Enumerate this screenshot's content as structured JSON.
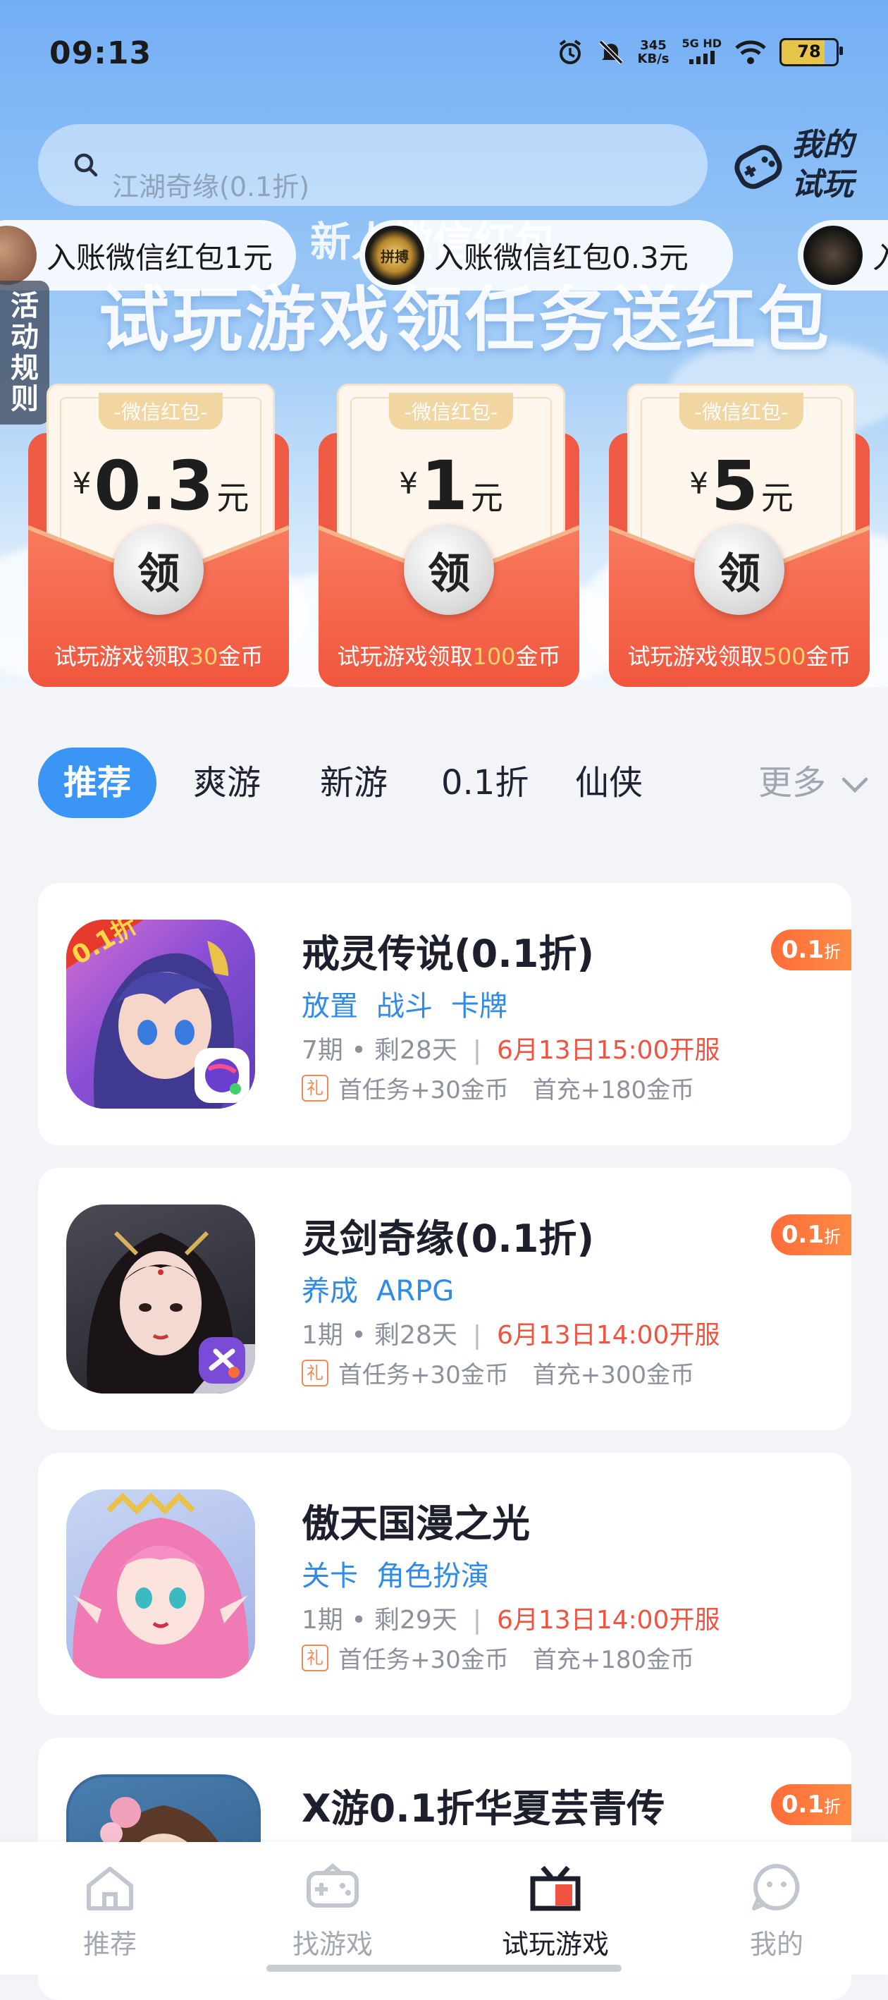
{
  "status_bar": {
    "time": "09:13",
    "net_speed_value": "345",
    "net_speed_unit": "KB/s",
    "network": "5G HD",
    "battery": "78"
  },
  "search": {
    "placeholder": "江湖奇缘(0.1折)",
    "icon": "search-icon"
  },
  "my_trial": {
    "label_line1": "我的",
    "label_line2": "试玩",
    "icon": "gamepad-icon"
  },
  "ticker": [
    {
      "text": "入账微信红包1元"
    },
    {
      "text": "入账微信红包0.3元",
      "avatar_text": "拼搏"
    },
    {
      "text": "入"
    }
  ],
  "banner": {
    "subtitle": "新人微信红包",
    "title": "试玩游戏领任务送红包",
    "side_rule": "活动规则"
  },
  "red_packets": [
    {
      "tag": "-微信红包-",
      "currency": "¥",
      "amount": "0.3",
      "unit": "元",
      "button": "领",
      "footer_prefix": "试玩游戏领取",
      "coins": "30",
      "footer_suffix": "金币"
    },
    {
      "tag": "-微信红包-",
      "currency": "¥",
      "amount": "1",
      "unit": "元",
      "button": "领",
      "footer_prefix": "试玩游戏领取",
      "coins": "100",
      "footer_suffix": "金币"
    },
    {
      "tag": "-微信红包-",
      "currency": "¥",
      "amount": "5",
      "unit": "元",
      "button": "领",
      "footer_prefix": "试玩游戏领取",
      "coins": "500",
      "footer_suffix": "金币"
    }
  ],
  "category_tabs": {
    "items": [
      "推荐",
      "爽游",
      "新游",
      "0.1折",
      "仙侠"
    ],
    "active": "推荐",
    "more": "更多"
  },
  "games": [
    {
      "name": "戒灵传说(0.1折)",
      "tags": [
        "放置",
        "战斗",
        "卡牌"
      ],
      "period": "7期",
      "remaining": "剩28天",
      "open_time": "6月13日15:00开服",
      "perk1": "首任务+30金币",
      "perk2": "首充+180金币",
      "discount": "0.1",
      "discount_unit": "折",
      "icon_badge": "0.1折",
      "colors": {
        "bg": "#7a4fc4",
        "hair": "#3f3a8f",
        "skin": "#f6d6c8"
      }
    },
    {
      "name": "灵剑奇缘(0.1折)",
      "tags": [
        "养成",
        "ARPG"
      ],
      "period": "1期",
      "remaining": "剩28天",
      "open_time": "6月13日14:00开服",
      "perk1": "首任务+30金币",
      "perk2": "首充+300金币",
      "discount": "0.1",
      "discount_unit": "折",
      "colors": {
        "bg": "#2a2a33",
        "hair": "#1a1416",
        "skin": "#f3d9cf"
      }
    },
    {
      "name": "傲天国漫之光",
      "tags": [
        "关卡",
        "角色扮演"
      ],
      "period": "1期",
      "remaining": "剩29天",
      "open_time": "6月13日14:00开服",
      "perk1": "首任务+30金币",
      "perk2": "首充+180金币",
      "colors": {
        "bg": "#b9c8ee",
        "hair": "#f07ab4",
        "skin": "#fbe2dc"
      }
    },
    {
      "name": "X游0.1折华夏芸青传",
      "tags": [],
      "discount": "0.1",
      "discount_unit": "折",
      "colors": {
        "bg": "#3d6d9c",
        "hair": "#5b3a2a",
        "skin": "#f4d8c6"
      }
    }
  ],
  "gift_label": "礼",
  "bottom_nav": {
    "items": [
      {
        "label": "推荐",
        "icon": "home-icon"
      },
      {
        "label": "找游戏",
        "icon": "gamepad-icon"
      },
      {
        "label": "试玩游戏",
        "icon": "gift-box-icon"
      },
      {
        "label": "我的",
        "icon": "profile-face-icon"
      }
    ],
    "active": "试玩游戏"
  },
  "colors": {
    "accent_blue": "#3a95f4",
    "packet_red": "#ee5a43",
    "discount_orange": "#ff6c39",
    "open_time_red": "#f0533f",
    "tag_blue": "#2f8ae8"
  }
}
